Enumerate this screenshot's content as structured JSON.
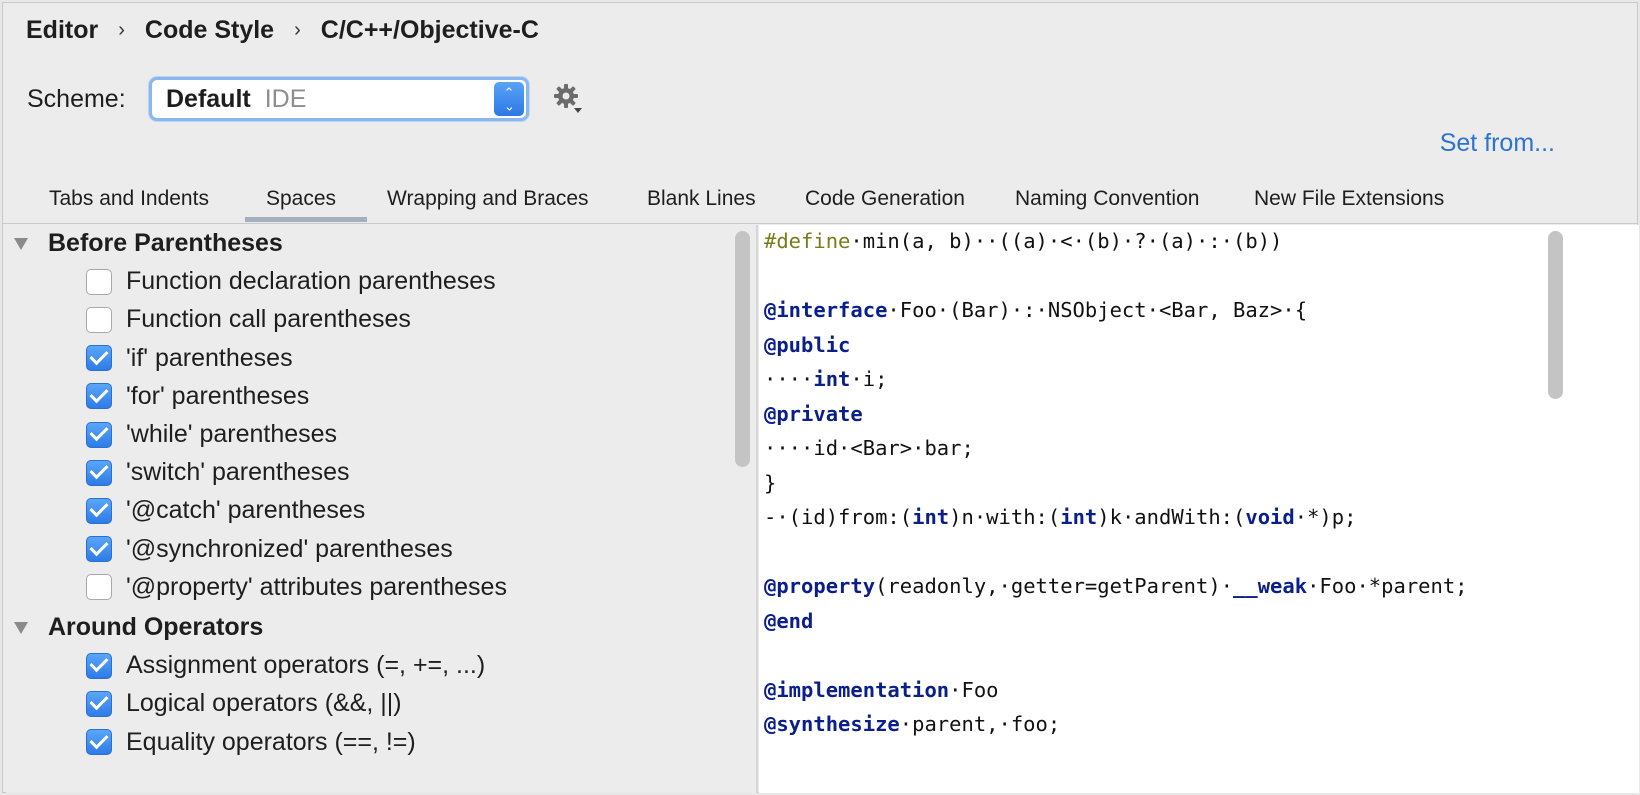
{
  "breadcrumb": {
    "items": [
      "Editor",
      "Code Style",
      "C/C++/Objective-C"
    ],
    "separator": "›"
  },
  "scheme": {
    "label": "Scheme:",
    "name": "Default",
    "type": "IDE"
  },
  "set_from": "Set from...",
  "tabs": [
    "Tabs and Indents",
    "Spaces",
    "Wrapping and Braces",
    "Blank Lines",
    "Code Generation",
    "Naming Convention",
    "New File Extensions"
  ],
  "selected_tab": "Spaces",
  "sections": [
    {
      "title": "Before Parentheses",
      "options": [
        {
          "label": "Function declaration parentheses",
          "checked": false
        },
        {
          "label": "Function call parentheses",
          "checked": false
        },
        {
          "label": "'if' parentheses",
          "checked": true
        },
        {
          "label": "'for' parentheses",
          "checked": true
        },
        {
          "label": "'while' parentheses",
          "checked": true
        },
        {
          "label": "'switch' parentheses",
          "checked": true
        },
        {
          "label": "'@catch' parentheses",
          "checked": true
        },
        {
          "label": "'@synchronized' parentheses",
          "checked": true
        },
        {
          "label": "'@property' attributes parentheses",
          "checked": false
        }
      ]
    },
    {
      "title": "Around Operators",
      "options": [
        {
          "label": "Assignment operators (=, +=, ...)",
          "checked": true
        },
        {
          "label": "Logical operators (&&, ||)",
          "checked": true
        },
        {
          "label": "Equality operators (==, !=)",
          "checked": true
        }
      ]
    }
  ],
  "code_preview": [
    [
      {
        "t": "#define",
        "c": "pp"
      },
      {
        "t": "·min(a, b)··((a)·<·(b)·?·(a)·:·(b))"
      }
    ],
    [],
    [
      {
        "t": "@interface",
        "c": "kw"
      },
      {
        "t": "·Foo·(Bar)·:·NSObject·<Bar, Baz>·{"
      }
    ],
    [
      {
        "t": "@public",
        "c": "kw"
      }
    ],
    [
      {
        "t": "····"
      },
      {
        "t": "int",
        "c": "kw"
      },
      {
        "t": "·i;"
      }
    ],
    [
      {
        "t": "@private",
        "c": "kw"
      }
    ],
    [
      {
        "t": "····id·<Bar>·bar;"
      }
    ],
    [
      {
        "t": "}"
      }
    ],
    [
      {
        "t": "-·(id)from:("
      },
      {
        "t": "int",
        "c": "kw"
      },
      {
        "t": ")n·with:("
      },
      {
        "t": "int",
        "c": "kw"
      },
      {
        "t": ")k·andWith:("
      },
      {
        "t": "void",
        "c": "kw"
      },
      {
        "t": "·*)p;"
      }
    ],
    [],
    [
      {
        "t": "@property",
        "c": "kw"
      },
      {
        "t": "(readonly,·getter=getParent)·"
      },
      {
        "t": "__weak",
        "c": "kw"
      },
      {
        "t": "·Foo·*parent;"
      }
    ],
    [
      {
        "t": "@end",
        "c": "kw"
      }
    ],
    [],
    [
      {
        "t": "@implementation",
        "c": "kw"
      },
      {
        "t": "·Foo"
      }
    ],
    [
      {
        "t": "@synthesize",
        "c": "kw"
      },
      {
        "t": "·parent,·foo;"
      }
    ]
  ]
}
